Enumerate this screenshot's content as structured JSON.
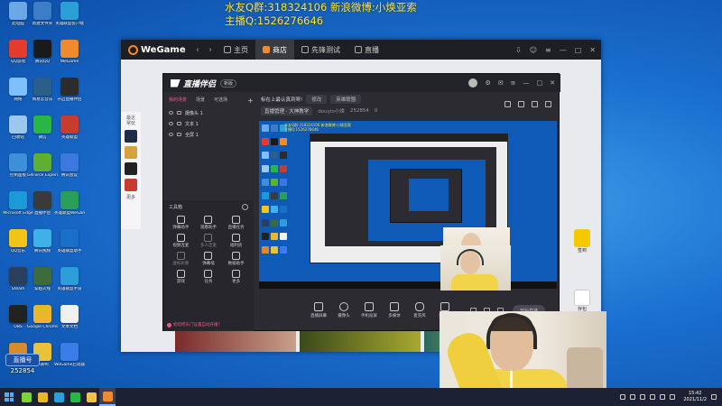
{
  "overlay": {
    "line1": "水友Q群:318324106 新浪微博:小焕亚索",
    "line2": "主播Q:1526276646"
  },
  "desktop_icons": [
    {
      "label": "此电脑",
      "color": "#6aa8e8"
    },
    {
      "label": "新建文件夹",
      "color": "#3c7dc8"
    },
    {
      "label": "英雄联盟客户端",
      "color": "#2a9fd8"
    },
    {
      "label": "QQ游戏",
      "color": "#e43c2c"
    },
    {
      "label": "腾讯QQ",
      "color": "#1a1a1a"
    },
    {
      "label": "WeGame",
      "color": "#f08a2c"
    },
    {
      "label": "网络",
      "color": "#7ec0ff"
    },
    {
      "label": "网易云音乐",
      "color": "#2b5f8a"
    },
    {
      "label": "开启直播伴侣",
      "color": "#2c2c2c"
    },
    {
      "label": "回收站",
      "color": "#9cc8f0"
    },
    {
      "label": "微信",
      "color": "#2ab644"
    },
    {
      "label": "英雄联盟",
      "color": "#c83c30"
    },
    {
      "label": "控制面板",
      "color": "#3d8fd8"
    },
    {
      "label": "GeForce Experience",
      "color": "#5fb032"
    },
    {
      "label": "腾讯会议",
      "color": "#3b78e0"
    },
    {
      "label": "Microsoft Edge",
      "color": "#1b9ad6"
    },
    {
      "label": "直播伴侣",
      "color": "#3a3a3a"
    },
    {
      "label": "英雄联盟WeGame版",
      "color": "#2a9f5a"
    },
    {
      "label": "QQ音乐",
      "color": "#f2c418"
    },
    {
      "label": "腾讯视频",
      "color": "#40b0e8"
    },
    {
      "label": "英雄联盟助手",
      "color": "#1a6fc8"
    },
    {
      "label": "Steam",
      "color": "#2a3f5c"
    },
    {
      "label": "穿越火线",
      "color": "#3c6a3c"
    },
    {
      "label": "英雄联盟手游",
      "color": "#2c9fd8"
    },
    {
      "label": "OBS",
      "color": "#222222"
    },
    {
      "label": "Google Chrome",
      "color": "#e8b82a"
    },
    {
      "label": "文本文档",
      "color": "#f0f0f0"
    },
    {
      "label": "LOL助手",
      "color": "#d88a2c"
    },
    {
      "label": "小黄鸭",
      "color": "#e8c33a"
    },
    {
      "label": "WeGame启动器",
      "color": "#3b7de8"
    }
  ],
  "wegame": {
    "brand": "WeGame",
    "tabs": [
      {
        "label": "主页",
        "active": false
      },
      {
        "label": "商店",
        "active": true
      },
      {
        "label": "先锋测试",
        "active": false
      },
      {
        "label": "直播",
        "active": false
      }
    ],
    "left_labels": [
      "最近",
      "常玩",
      "更多"
    ],
    "side_label": "签到",
    "side_label2": "存包"
  },
  "stream": {
    "title": "直播伴侣",
    "version": "新版",
    "scene_tabs": [
      "我的场景",
      "场景",
      "可选场"
    ],
    "scenes": [
      {
        "label": "摄像头 1"
      },
      {
        "label": "文本 1"
      },
      {
        "label": "全屏 1"
      }
    ],
    "tools_title": "工具箱",
    "tools": [
      {
        "label": "弹幕助手",
        "dim": false
      },
      {
        "label": "观看助手",
        "dim": false
      },
      {
        "label": "直播任务",
        "dim": false
      },
      {
        "label": "视频连麦",
        "dim": false
      },
      {
        "label": "多人连麦",
        "dim": true
      },
      {
        "label": "福利房",
        "dim": false
      },
      {
        "label": "虚拟形象",
        "dim": true
      },
      {
        "label": "弹幕墙",
        "dim": false
      },
      {
        "label": "数据助手",
        "dim": false
      },
      {
        "label": "游戏",
        "dim": false
      },
      {
        "label": "任务",
        "dim": false
      },
      {
        "label": "更多",
        "dim": false
      }
    ],
    "tip": "如何把东门设置自动开播?",
    "topbar": {
      "room_title": "标在上最认真到呀!",
      "edit": "修改",
      "category": "英雄联盟",
      "channel": "直播管理 · 大神教学",
      "username": "douyin小焕",
      "count1": "252854",
      "count2": "0"
    },
    "preview_text1": "水友Q群:318324106 新浪微博:小焕亚索",
    "preview_text2": "主播Q:1526276646",
    "bottom_buttons": [
      "直播屏幕",
      "摄像头",
      "手机投屏",
      "多媒体",
      "麦克风",
      "扬声器"
    ],
    "live_button": "开始直播"
  },
  "qq_badge": {
    "label": "直播号",
    "number": "252854"
  },
  "taskbar": {
    "apps": [
      {
        "name": "cortana",
        "color": "#7dd23a"
      },
      {
        "name": "chrome",
        "color": "#e8b82a"
      },
      {
        "name": "lol-helper",
        "color": "#2a9fd8"
      },
      {
        "name": "wechat",
        "color": "#2ab644"
      },
      {
        "name": "folder",
        "color": "#f0c24a"
      },
      {
        "name": "wegame",
        "color": "#f08a2c"
      }
    ],
    "time": "15:42",
    "date": "2021/11/2"
  }
}
